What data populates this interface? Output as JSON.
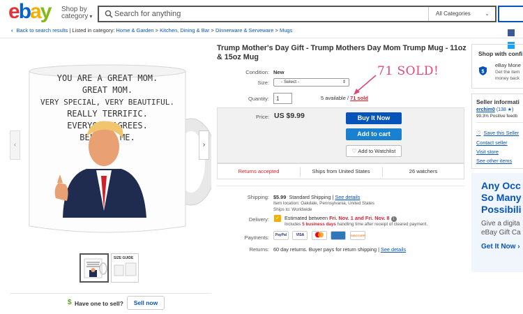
{
  "header": {
    "logo": {
      "e": "e",
      "b": "b",
      "a": "a",
      "y": "y"
    },
    "shop_by_line1": "Shop by",
    "shop_by_line2": "category",
    "search_placeholder": "Search for anything",
    "category_select": "All Categories"
  },
  "breadcrumb": {
    "back": "Back to search results",
    "listed_in": "| Listed in category:",
    "items": [
      "Home & Garden",
      "Kitchen, Dining & Bar",
      "Dinnerware & Serveware",
      "Mugs"
    ],
    "separator": ">"
  },
  "gallery": {
    "mug_lines": [
      "YOU ARE A GREAT MOM.",
      "GREAT MOM.",
      "VERY SPECIAL, VERY BEAUTIFUL.",
      "REALLY TERRIFIC.",
      "EVERYONE AGREES.",
      "BELIEVE ME."
    ],
    "thumb2_label": "SIZE GUIDE",
    "prev_arrow": "‹",
    "next_arrow": "›"
  },
  "sell": {
    "icon": "$",
    "prompt": "Have one to sell?",
    "button": "Sell now"
  },
  "item": {
    "title": "Trump Mother's Day Gift - Trump Mothers Day Mom Trump Mug - 11oz & 15oz Mug",
    "condition_label": "Condition:",
    "condition_value": "New",
    "size_label": "Size:",
    "size_value": "- Select -",
    "quantity_label": "Quantity:",
    "quantity_value": "1",
    "available": "5 available / ",
    "sold": "71 sold",
    "annotation": "71 SOLD!",
    "annotation_color": "#e0457b",
    "price_label": "Price:",
    "price_value": "US $9.99",
    "buy_now": "Buy It Now",
    "add_to_cart": "Add to cart",
    "watchlist": "Add to Watchlist",
    "badges": [
      "Returns accepted",
      "Ships from United States",
      "26 watchers"
    ]
  },
  "shipping": {
    "label": "Shipping:",
    "cost": "$5.99",
    "method": "Standard Shipping",
    "see_details": "See details",
    "location": "Item location:  Oakdale, Pennsylvania, United States",
    "ships_to": "Ships to:  Worldwide"
  },
  "delivery": {
    "label": "Delivery:",
    "estimated": "Estimated between ",
    "dates": "Fri. Nov. 1 and Fri. Nov. 8",
    "includes_pre": "Includes ",
    "business_days": "5 business days",
    "includes_post": " handling time after receipt of cleared payment."
  },
  "payments": {
    "label": "Payments:",
    "methods": [
      "PayPal",
      "VISA",
      "MC",
      "AMEX",
      "DISCOVER"
    ]
  },
  "returns": {
    "label": "Returns:",
    "value": "60 day returns. Buyer pays for return shipping | ",
    "see_details": "See details"
  },
  "right": {
    "shop_confidence": "Shop with confi",
    "money_back_title": "eBay Mone",
    "money_back_sub1": "Get the item",
    "money_back_sub2": "money back",
    "seller_title": "Seller informati",
    "seller_name": "erchim0",
    "seller_feedback_score": "(138",
    "seller_feedback_pct": "99.3% Positive feedb",
    "save_seller": "Save this Seller",
    "contact_seller": "Contact seller",
    "visit_store": "Visit store",
    "see_other_items": "See other items",
    "ad_headline": "Any Occ\nSo Many\nPossibili",
    "ad_sub": "Give a digita\neBay Gift Ca",
    "ad_cta": "Get It Now"
  },
  "colors": {
    "ebay_red": "#e53238",
    "ebay_blue": "#0654ba",
    "ebay_yellow": "#f5af02",
    "ebay_green": "#86b817",
    "alert_red": "#dd1e31"
  }
}
